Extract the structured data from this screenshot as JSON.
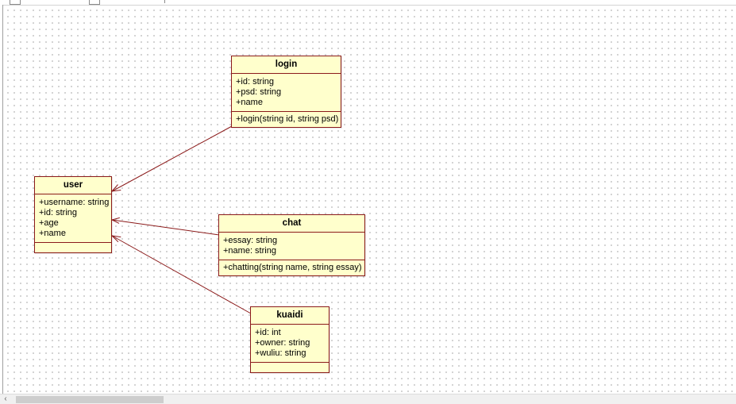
{
  "diagram": {
    "classes": {
      "login": {
        "name": "login",
        "attributes": [
          "+id: string",
          "+psd: string",
          "+name"
        ],
        "operations": [
          "+login(string id, string psd)"
        ]
      },
      "user": {
        "name": "user",
        "attributes": [
          "+username: string",
          "+id: string",
          "+age",
          "+name"
        ],
        "operations": []
      },
      "chat": {
        "name": "chat",
        "attributes": [
          "+essay: string",
          "+name: string"
        ],
        "operations": [
          "+chatting(string name, string essay)"
        ]
      },
      "kuaidi": {
        "name": "kuaidi",
        "attributes": [
          "+id: int",
          "+owner: string",
          "+wuliu: string"
        ],
        "operations": []
      }
    },
    "relations": [
      {
        "from": "login",
        "to": "user",
        "type": "association-arrow"
      },
      {
        "from": "chat",
        "to": "user",
        "type": "association-arrow"
      },
      {
        "from": "kuaidi",
        "to": "user",
        "type": "association-arrow"
      }
    ]
  },
  "colors": {
    "class_fill": "#ffffcc",
    "class_border": "#8b1a1a",
    "relation_line": "#8b1a1a"
  },
  "scrollbar": {
    "left_arrow_icon": "chevron-left-icon"
  }
}
